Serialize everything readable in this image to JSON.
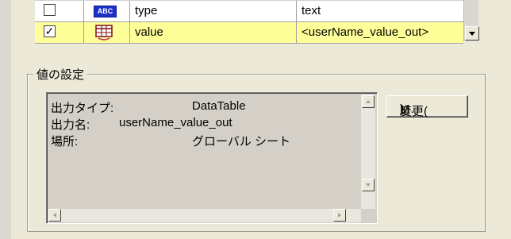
{
  "grid": {
    "rows": [
      {
        "checked": false,
        "type_icon": "abc-text-type-icon",
        "icon_text": "ABC",
        "name": "type",
        "value": "text",
        "highlighted": false
      },
      {
        "checked": true,
        "type_icon": "datatable-grid-icon",
        "icon_text": "",
        "name": "value",
        "value": "<userName_value_out>",
        "highlighted": true
      }
    ],
    "check_mark": "✓",
    "highlight_color": "#ffff99"
  },
  "groupbox": {
    "legend": "値の設定"
  },
  "info": {
    "lines": [
      {
        "label": "出力タイプ:",
        "value": "DataTable"
      },
      {
        "label": "出力名:",
        "value": "userName_value_out"
      },
      {
        "label": "場所:",
        "value": "グローバル シート"
      }
    ]
  },
  "change_button": {
    "label": "変更(",
    "accel": "M",
    "suffix": ")..."
  }
}
